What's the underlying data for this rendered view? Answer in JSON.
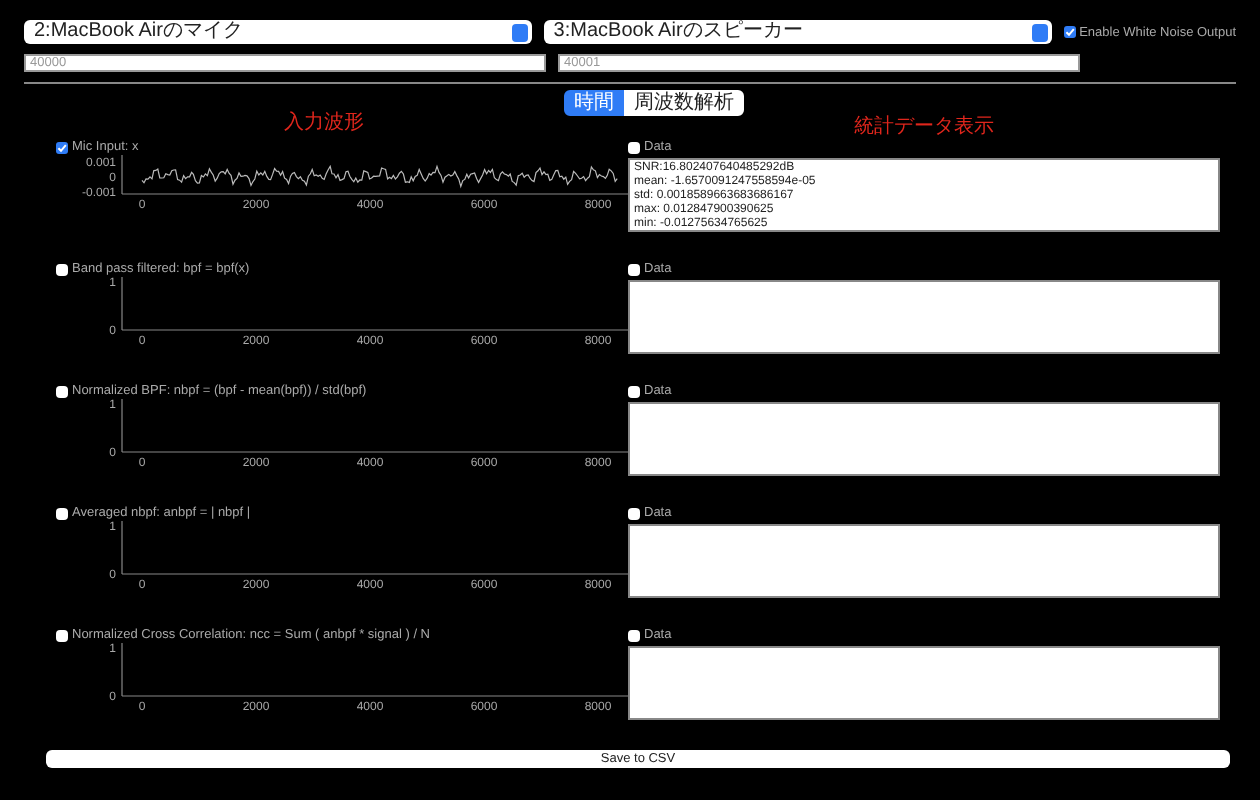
{
  "devices": {
    "input": {
      "value": "2:MacBook Airのマイク"
    },
    "output": {
      "value": "3:MacBook Airのスピーカー"
    },
    "white_noise": {
      "label": "Enable White Noise Output",
      "checked": true
    }
  },
  "ports": [
    {
      "placeholder": "40000"
    },
    {
      "placeholder": "40001"
    }
  ],
  "tabs": [
    {
      "label": "時間",
      "selected": true
    },
    {
      "label": "周波数解析",
      "selected": false
    }
  ],
  "headers": {
    "left": "入力波形",
    "right": "統計データ表示"
  },
  "rows": [
    {
      "label": "Mic Input: x",
      "checked": true,
      "kind": "waveform",
      "y_ticks": [
        "0.001",
        "0",
        "-0.001"
      ],
      "x_ticks": [
        "0",
        "2000",
        "4000",
        "6000",
        "8000"
      ],
      "data": {
        "label": "Data",
        "checked": false,
        "lines": [
          "SNR:16.802407640485292dB",
          "mean: -1.6570091247558594e-05",
          "std: 0.0018589663683686167",
          "max: 0.012847900390625",
          "min: -0.01275634765625"
        ]
      }
    },
    {
      "label": "Band pass filtered: bpf = bpf(x)",
      "checked": false,
      "kind": "empty",
      "y_ticks": [
        "1",
        "0"
      ],
      "x_ticks": [
        "0",
        "2000",
        "4000",
        "6000",
        "8000"
      ],
      "data": {
        "label": "Data",
        "checked": false
      }
    },
    {
      "label": "Normalized BPF: nbpf = (bpf - mean(bpf)) / std(bpf)",
      "checked": false,
      "kind": "empty",
      "y_ticks": [
        "1",
        "0"
      ],
      "x_ticks": [
        "0",
        "2000",
        "4000",
        "6000",
        "8000"
      ],
      "data": {
        "label": "Data",
        "checked": false
      }
    },
    {
      "label": "Averaged nbpf: anbpf = | nbpf |",
      "checked": false,
      "kind": "empty",
      "y_ticks": [
        "1",
        "0"
      ],
      "x_ticks": [
        "0",
        "2000",
        "4000",
        "6000",
        "8000"
      ],
      "data": {
        "label": "Data",
        "checked": false
      }
    },
    {
      "label": "Normalized Cross Correlation: ncc = Sum ( anbpf * signal ) / N",
      "checked": false,
      "kind": "empty",
      "y_ticks": [
        "1",
        "0"
      ],
      "x_ticks": [
        "0",
        "2000",
        "4000",
        "6000",
        "8000"
      ],
      "data": {
        "label": "Data",
        "checked": false
      }
    }
  ],
  "save_button": "Save to CSV"
}
